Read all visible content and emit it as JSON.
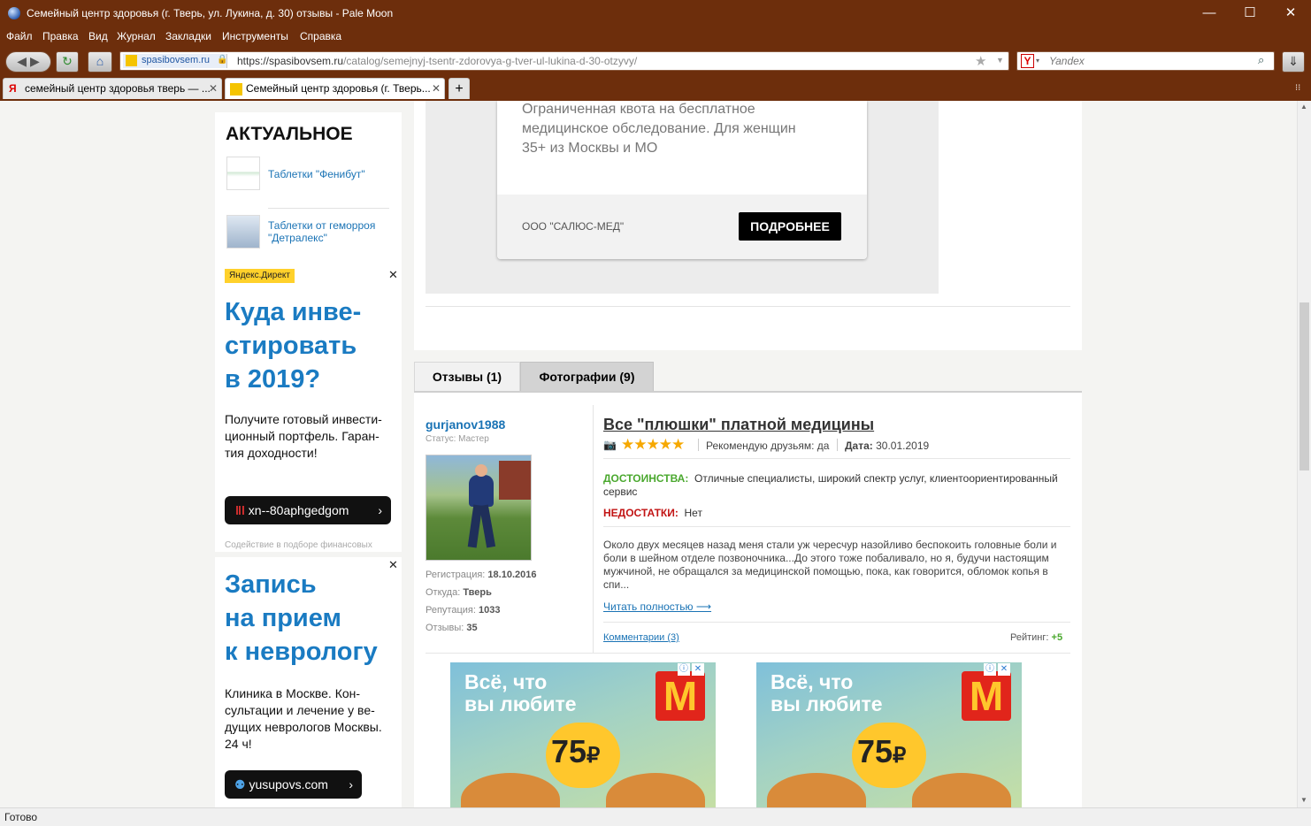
{
  "window": {
    "title": "Семейный центр здоровья (г. Тверь, ул. Лукина, д. 30) отзывы - Pale Moon"
  },
  "menu": [
    "Файл",
    "Правка",
    "Вид",
    "Журнал",
    "Закладки",
    "Инструменты",
    "Справка"
  ],
  "nav": {
    "site_badge": "spasibovsem.ru",
    "url_host": "https://spasibovsem.ru",
    "url_path": "/catalog/semejnyj-tsentr-zdorovya-g-tver-ul-lukina-d-30-otzyvy/",
    "search_placeholder": "Yandex"
  },
  "tabs": [
    {
      "label": "семейный центр здоровья тверь — ..."
    },
    {
      "label": "Семейный центр здоровья (г. Тверь..."
    }
  ],
  "status": "Готово",
  "sidebar": {
    "actual_title": "АКТУАЛЬНОЕ",
    "items": [
      {
        "label": "Таблетки \"Фенибут\""
      },
      {
        "label": "Таблетки от геморроя \"Детралекс\""
      }
    ],
    "ad1": {
      "badge": "Яндекс.Директ",
      "headline_l1": "Куда инве-",
      "headline_l2": "стировать",
      "headline_l3": "в 2019?",
      "text_l1": "Получите готовый инвести-",
      "text_l2": "ционный портфель. Гаран-",
      "text_l3": "тия доходности!",
      "button": "xn--80aphgedgom",
      "footer": "Содействие в подборе финансовых"
    },
    "ad2": {
      "headline_l1": "Запись",
      "headline_l2": "на прием",
      "headline_l3": "к неврологу",
      "text_l1": "Клиника в Москве. Кон-",
      "text_l2": "сультации и лечение у ве-",
      "text_l3": "дущих неврологов Москвы.",
      "text_l4": "24 ч!",
      "button": "yusupovs.com"
    }
  },
  "top_ad": {
    "line1": "Ограниченная квота на бесплатное",
    "line2": "медицинское обследование. Для женщин",
    "line3": "35+ из Москвы и МО",
    "company": "ООО \"САЛЮС-МЕД\"",
    "button": "ПОДРОБНЕЕ"
  },
  "review_tabs": [
    "Отзывы (1)",
    "Фотографии (9)"
  ],
  "review": {
    "username": "gurjanov1988",
    "status_label": "Статус:",
    "status": "Мастер",
    "reg_label": "Регистрация:",
    "reg": "18.10.2016",
    "from_label": "Откуда:",
    "from": "Тверь",
    "rep_label": "Репутация:",
    "rep": "1033",
    "reviews_label": "Отзывы:",
    "reviews": "35",
    "title": "Все \"плюшки\" платной медицины",
    "stars": 5,
    "recommend": "Рекомендую друзьям: да",
    "date_label": "Дата:",
    "date": "30.01.2019",
    "pros_label": "ДОСТОИНСТВА:",
    "pros": "Отличные специалисты, широкий спектр услуг, клиентоориентированный сервис",
    "cons_label": "НЕДОСТАТКИ:",
    "cons": "Нет",
    "body": "Около двух месяцев назад меня стали уж чересчур назойливо беспокоить головные боли и боли в шейном отделе позвоночника...До этого тоже побаливало, но я, будучи настоящим мужчиной, не обращался за медицинской помощью, пока, как говорится, обломок копья в спи...",
    "read_more": "Читать полностью ⟶",
    "comments": "Комментарии (3)",
    "rating_label": "Рейтинг:",
    "rating": "+5"
  },
  "mc_ad": {
    "line1": "Всё, что",
    "line2": "вы любите",
    "price": "75",
    "currency": "₽"
  }
}
